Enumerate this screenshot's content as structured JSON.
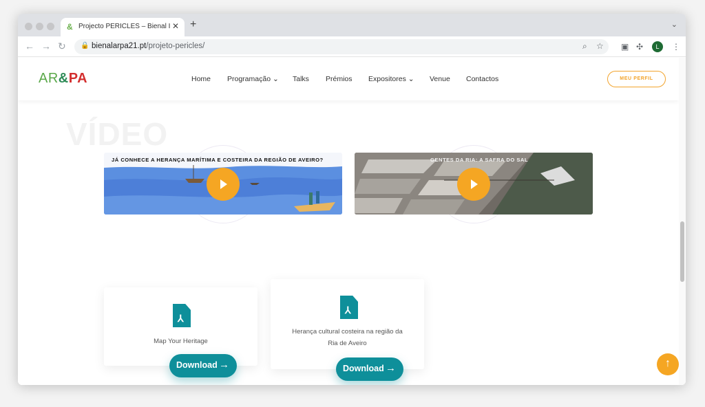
{
  "browser": {
    "tab_title": "Projecto PERICLES – Bienal Ibé",
    "tab_close": "✕",
    "new_tab": "+",
    "url_domain": "bienalarpa21.pt",
    "url_path": "/projeto-pericles/",
    "profile_initial": "L"
  },
  "site": {
    "logo": {
      "part1": "AR",
      "part2": "&",
      "part3": "PA"
    },
    "nav": {
      "home": "Home",
      "programacao": "Programação",
      "talks": "Talks",
      "premios": "Prémios",
      "expositores": "Expositores",
      "venue": "Venue",
      "contactos": "Contactos"
    },
    "perfil_button": "MEU PERFIL"
  },
  "section": {
    "title": "VÍDEO"
  },
  "videos": [
    {
      "title": "JÁ CONHECE A HERANÇA MARÍTIMA E COSTEIRA DA REGIÃO DE AVEIRO?"
    },
    {
      "title": "GENTES DA RIA: A SAFRA DO SAL"
    }
  ],
  "downloads": [
    {
      "text": "Map Your Heritage",
      "button": "Download"
    },
    {
      "text_line1": "Herança cultural costeira na região da",
      "text_line2": "Ria de Aveiro",
      "button": "Download"
    }
  ],
  "colors": {
    "accent_orange": "#f5a623",
    "teal": "#0e8f9a"
  },
  "icons": {
    "play": "play-icon",
    "pdf": "pdf-file-icon",
    "arrow": "arrow-right-icon",
    "to_top": "arrow-up-icon"
  }
}
